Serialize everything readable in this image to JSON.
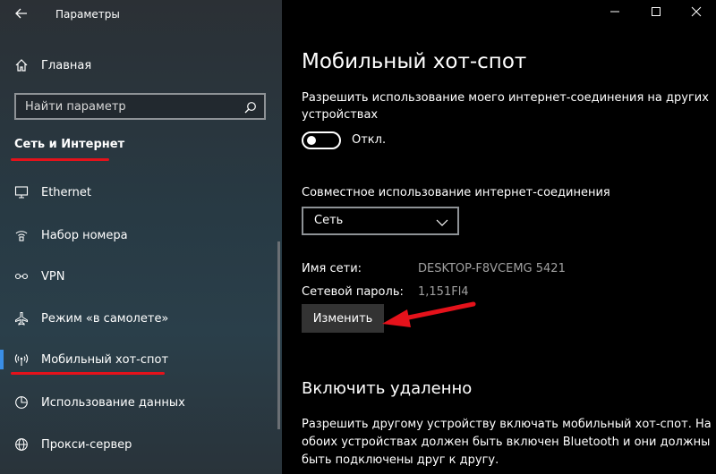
{
  "window": {
    "title": "Параметры",
    "back_icon": "back-arrow-icon",
    "controls": [
      "minimize-icon",
      "maximize-icon",
      "close-icon"
    ]
  },
  "sidebar": {
    "home_label": "Главная",
    "search": {
      "placeholder": "Найти параметр"
    },
    "section_title": "Сеть и Интернет",
    "items": [
      {
        "label": "Ethernet",
        "icon": "ethernet-icon"
      },
      {
        "label": "Набор номера",
        "icon": "dialup-icon"
      },
      {
        "label": "VPN",
        "icon": "vpn-icon"
      },
      {
        "label": "Режим «в самолете»",
        "icon": "airplane-icon"
      },
      {
        "label": "Мобильный хот-спот",
        "icon": "hotspot-icon",
        "active": true
      },
      {
        "label": "Использование данных",
        "icon": "data-usage-icon"
      },
      {
        "label": "Прокси-сервер",
        "icon": "globe-icon"
      }
    ]
  },
  "main": {
    "title": "Мобильный хот-спот",
    "share_desc_line1": "Разрешить использование моего интернет-соединения на других",
    "share_desc_line2": "устройствах",
    "toggle_state": "Откл.",
    "sharing_label": "Совместное использование интернет-соединения",
    "sharing_select": "Сеть",
    "network_name_key": "Имя сети:",
    "network_name_val": "DESKTOP-F8VCEMG 5421",
    "password_key": "Сетевой пароль:",
    "password_val": "1,151Fl4",
    "change_button": "Изменить",
    "remote_heading": "Включить удаленно",
    "remote_desc_line1": "Разрешить другому устройству включать мобильный хот-спот. На",
    "remote_desc_line2": "обоих устройствах должен быть включен Bluetooth и они должны",
    "remote_desc_line3": "быть подключены друг к другу."
  },
  "colors": {
    "annotation_red": "#e5121b",
    "accent": "#3a8ee6"
  }
}
